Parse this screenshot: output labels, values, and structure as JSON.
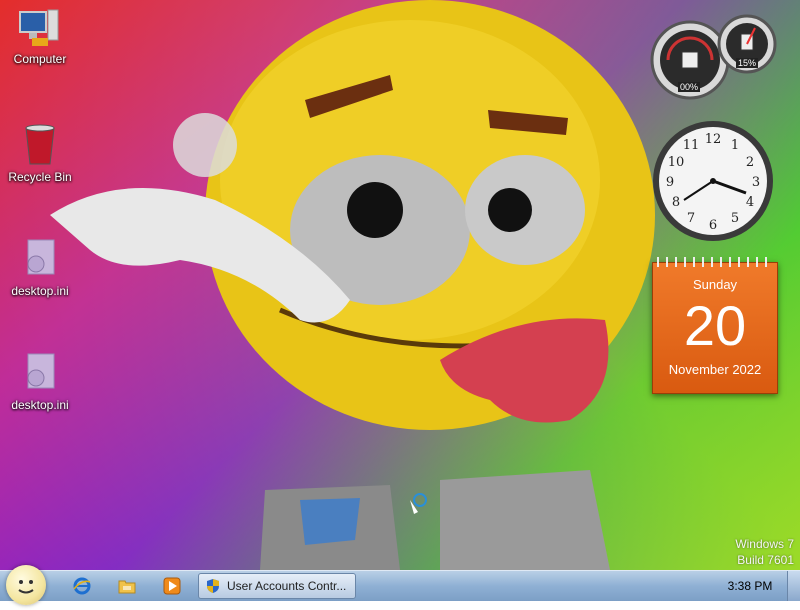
{
  "desktop_icons": [
    {
      "label": "Computer",
      "icon": "computer-icon"
    },
    {
      "label": "Recycle Bin",
      "icon": "recycle-bin-icon"
    },
    {
      "label": "desktop.ini",
      "icon": "settings-file-icon"
    },
    {
      "label": "desktop.ini",
      "icon": "settings-file-icon"
    }
  ],
  "gadgets": {
    "cpu_meter": {
      "cpu_usage": "00%",
      "memory_usage": "15%"
    },
    "calendar": {
      "weekday": "Sunday",
      "day": "20",
      "month_year": "November 2022"
    }
  },
  "watermark": {
    "line1": "Windows 7",
    "line2": "Build 7601"
  },
  "taskbar": {
    "task_label": "User Accounts Contr...",
    "time": "3:38 PM"
  },
  "colors": {
    "calendar": "#e8691a",
    "taskbar": "#9bb8d8"
  }
}
